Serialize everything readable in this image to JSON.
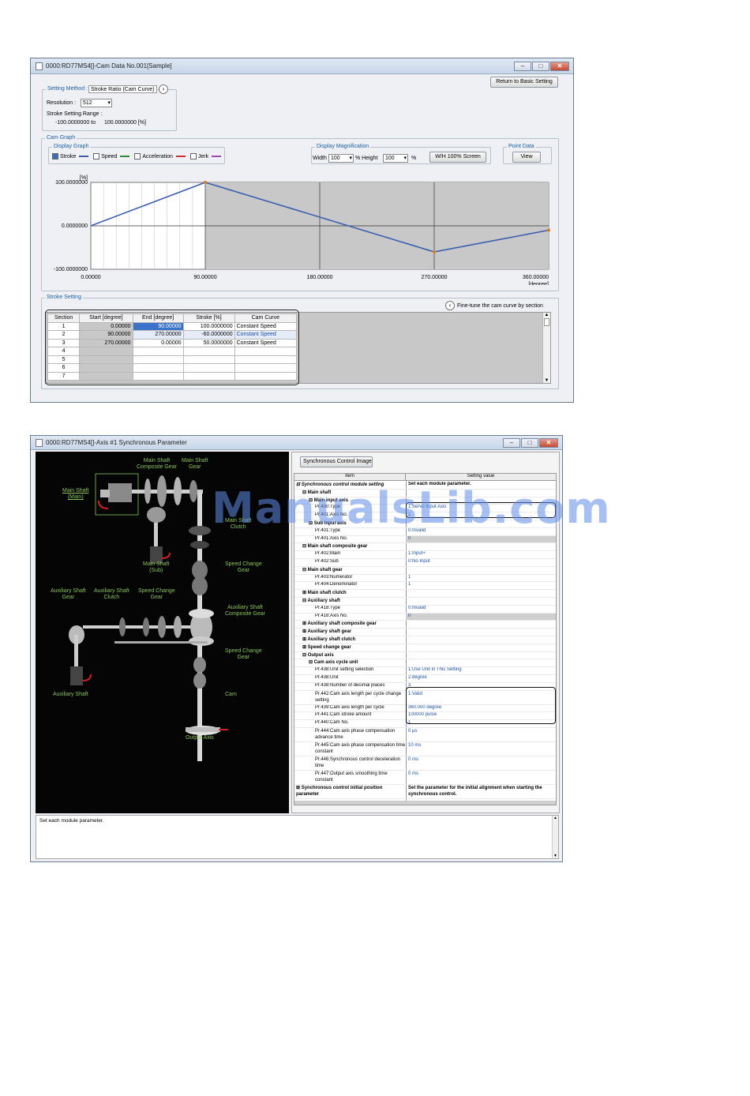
{
  "cam_window": {
    "title": "0000:RD77MS4[]-Cam Data No.001[Sample]",
    "return_button": "Return to Basic Setting",
    "setting_method_label": "Setting Method :",
    "setting_method_value": "Stroke Ratio (Cam Curve)",
    "resolution_label": "Resolution :",
    "resolution_value": "512",
    "stroke_range_label": "Stroke Setting Range :",
    "stroke_range_min": "-100.0000000 to",
    "stroke_range_max": "100.0000000 [%]",
    "cam_graph_label": "Cam Graph",
    "display_graph_label": "Display Graph",
    "legend": [
      "Stroke",
      "Speed",
      "Acceleration",
      "Jerk"
    ],
    "display_mag_label": "Display Magnification",
    "width_label": "Width",
    "width_value": "100",
    "height_label": "% Height",
    "height_value": "100",
    "pct": "%",
    "wh_button": "W/H 100% Screen",
    "point_data_label": "Point Data",
    "view_button": "View",
    "stroke_setting_label": "Stroke Setting",
    "fine_tune_label": "Fine-tune the cam curve by section",
    "table_headers": [
      "Section",
      "Start [degree]",
      "End [degree]",
      "Stroke [%]",
      "Cam Curve"
    ],
    "table_rows": [
      [
        "1",
        "0.00000",
        "90.00000",
        "100.0000000",
        "Constant Speed"
      ],
      [
        "2",
        "90.00000",
        "270.00000",
        "-60.0000000",
        "Constant Speed"
      ],
      [
        "3",
        "270.00000",
        "0.00000",
        "50.0000000",
        "Constant Speed"
      ],
      [
        "4",
        "",
        "",
        "",
        ""
      ],
      [
        "5",
        "",
        "",
        "",
        ""
      ],
      [
        "6",
        "",
        "",
        "",
        ""
      ],
      [
        "7",
        "",
        "",
        "",
        ""
      ]
    ]
  },
  "chart_data": {
    "type": "line",
    "series": [
      {
        "x": [
          0,
          90,
          270,
          360
        ],
        "y": [
          0,
          100,
          -60,
          -10
        ]
      }
    ],
    "xlabel": "[degree]",
    "ylabel": "[%]",
    "xlim": [
      0,
      360
    ],
    "ylim": [
      -100,
      100
    ],
    "x_ticks": [
      "0.00000",
      "90.00000",
      "180.00000",
      "270.00000",
      "360.00000"
    ],
    "y_ticks": [
      "100.0000000",
      "0.0000000",
      "-100.0000000"
    ],
    "grid": true,
    "colors": {
      "line": "#3a5fb0",
      "points": "#e07a20",
      "shade": "#c8c8c8"
    }
  },
  "sync_window": {
    "title": "0000:RD77MS4[]-Axis #1 Synchronous Parameter",
    "sync_image_button": "Synchronous Control Image",
    "col_item": "Item",
    "col_value": "Setting value",
    "footer_text": "Set each module parameter.",
    "gear_labels": {
      "main_shaft_main": "Main Shaft\n(Main)",
      "main_shaft_composite": "Main Shaft\nComposite Gear",
      "main_shaft_gear": "Main Shaft\nGear",
      "main_shaft_clutch": "Main Shaft\nClutch",
      "main_shaft_sub": "Main Shaft\n(Sub)",
      "speed_change_gear1": "Speed Change\nGear",
      "aux_shaft_gear": "Auxiliary Shaft\nGear",
      "aux_shaft_clutch": "Auxiliary Shaft\nClutch",
      "speed_change_gear2": "Speed Change\nGear",
      "aux_shaft_composite": "Auxiliary Shaft\nComposite Gear",
      "speed_change_gear3": "Speed Change\nGear",
      "aux_shaft": "Auxiliary Shaft",
      "cam": "Cam",
      "output_axis": "Output Axis"
    },
    "params": [
      {
        "item": "⊟ Synchronous control module setting",
        "value": "Set each module parameter.",
        "bold": true,
        "italic": true,
        "level": 0
      },
      {
        "item": "⊟ Main shaft",
        "value": "",
        "bold": true,
        "level": 1
      },
      {
        "item": "⊟ Main input axis",
        "value": "",
        "bold": true,
        "level": 2
      },
      {
        "item": "Pr.400:Type",
        "value": "1:Servo Input Axis",
        "level": 3
      },
      {
        "item": "Pr.401:Axis No.",
        "value": "1",
        "level": 3
      },
      {
        "item": "⊟ Sub input axis",
        "value": "",
        "bold": true,
        "level": 2
      },
      {
        "item": "Pr.401:Type",
        "value": "0:Invalid",
        "level": 3
      },
      {
        "item": "Pr.401:Axis No.",
        "value": "0",
        "level": 3,
        "gray": true
      },
      {
        "item": "⊟ Main shaft composite gear",
        "value": "",
        "bold": true,
        "level": 1
      },
      {
        "item": "Pr.402:Main",
        "value": "1:Input+",
        "level": 3
      },
      {
        "item": "Pr.402:Sub",
        "value": "0:No Input",
        "level": 3
      },
      {
        "item": "⊟ Main shaft gear",
        "value": "",
        "bold": true,
        "level": 1
      },
      {
        "item": "Pr.403:Numerator",
        "value": "1",
        "level": 3
      },
      {
        "item": "Pr.404:Denominator",
        "value": "1",
        "level": 3
      },
      {
        "item": "⊞ Main shaft clutch",
        "value": "",
        "bold": true,
        "level": 1
      },
      {
        "item": "⊟ Auxiliary shaft",
        "value": "",
        "bold": true,
        "level": 1
      },
      {
        "item": "Pr.418:Type",
        "value": "0:Invalid",
        "level": 3
      },
      {
        "item": "Pr.418:Axis No.",
        "value": "0",
        "level": 3,
        "gray": true
      },
      {
        "item": "⊞ Auxiliary shaft composite gear",
        "value": "",
        "bold": true,
        "level": 1
      },
      {
        "item": "⊞ Auxiliary shaft gear",
        "value": "",
        "bold": true,
        "level": 1
      },
      {
        "item": "⊞ Auxiliary shaft clutch",
        "value": "",
        "bold": true,
        "level": 1
      },
      {
        "item": "⊞ Speed change gear",
        "value": "",
        "bold": true,
        "level": 1
      },
      {
        "item": "⊟ Output axis",
        "value": "",
        "bold": true,
        "level": 1
      },
      {
        "item": "⊟ Cam axis cycle unit",
        "value": "",
        "bold": true,
        "level": 2
      },
      {
        "item": "Pr.438:Unit setting selection",
        "value": "1:Use Unit in This Setting",
        "level": 3
      },
      {
        "item": "Pr.438:Unit",
        "value": "2:degree",
        "level": 3
      },
      {
        "item": "Pr.438:Number of decimal places",
        "value": "3",
        "level": 3
      },
      {
        "item": "Pr.442:Cam axis length per cycle change setting",
        "value": "1:Valid",
        "level": 3,
        "tall": true
      },
      {
        "item": "Pr.439:Cam axis length per cycle",
        "value": "360.000 degree",
        "level": 3
      },
      {
        "item": "Pr.441:Cam stroke amount",
        "value": "100000 pulse",
        "level": 3
      },
      {
        "item": "Pr.440:Cam No.",
        "value": "1",
        "level": 3
      },
      {
        "item": "Pr.444:Cam axis phase compensation advance time",
        "value": "0 μs",
        "level": 3,
        "tall": true
      },
      {
        "item": "Pr.445:Cam axis phase compensation time constant",
        "value": "10 ms",
        "level": 3,
        "tall": true
      },
      {
        "item": "Pr.446:Synchronous control deceleration time",
        "value": "0 ms",
        "level": 3,
        "tall": true
      },
      {
        "item": "Pr.447:Output axis smoothing time constant",
        "value": "0 ms",
        "level": 3,
        "tall": true
      },
      {
        "item": "⊞ Synchronous control initial position parameter",
        "value": "Set the parameter for the initial alignment when starting the synchronous control.",
        "bold": true,
        "level": 0,
        "tall": true
      }
    ]
  },
  "watermark": "ManualsLib.com"
}
